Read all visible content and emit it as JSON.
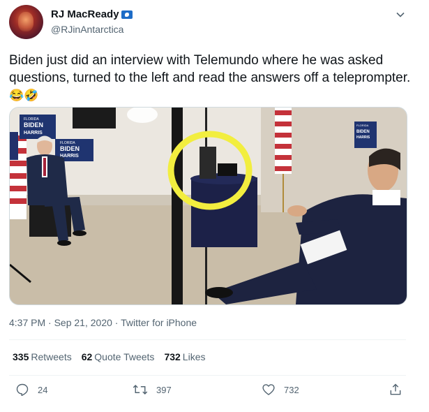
{
  "author": {
    "display_name": "RJ MacReady",
    "handle": "@RJinAntarctica"
  },
  "tweet": {
    "text": "Biden just did an interview with Telemundo where he was asked questions, turned to the left and read the answers off a teleprompter.",
    "emoji": "😂🤣"
  },
  "media": {
    "sign_top": "FLORIDA",
    "sign_biden": "BIDEN",
    "sign_harris": "HARRIS",
    "highlight_color": "#f2ee3f"
  },
  "meta": {
    "time": "4:37 PM",
    "date": "Sep 21, 2020",
    "source": "Twitter for iPhone",
    "sep": " · "
  },
  "stats": {
    "retweets_count": "335",
    "retweets_label": "Retweets",
    "quote_count": "62",
    "quote_label": "Quote Tweets",
    "likes_count": "732",
    "likes_label": "Likes"
  },
  "actions": {
    "reply_count": "24",
    "retweet_count": "397",
    "like_count": "732"
  },
  "colors": {
    "text_secondary": "#536471",
    "divider": "#eff3f4",
    "verified_flag": "#1d6cc7"
  }
}
